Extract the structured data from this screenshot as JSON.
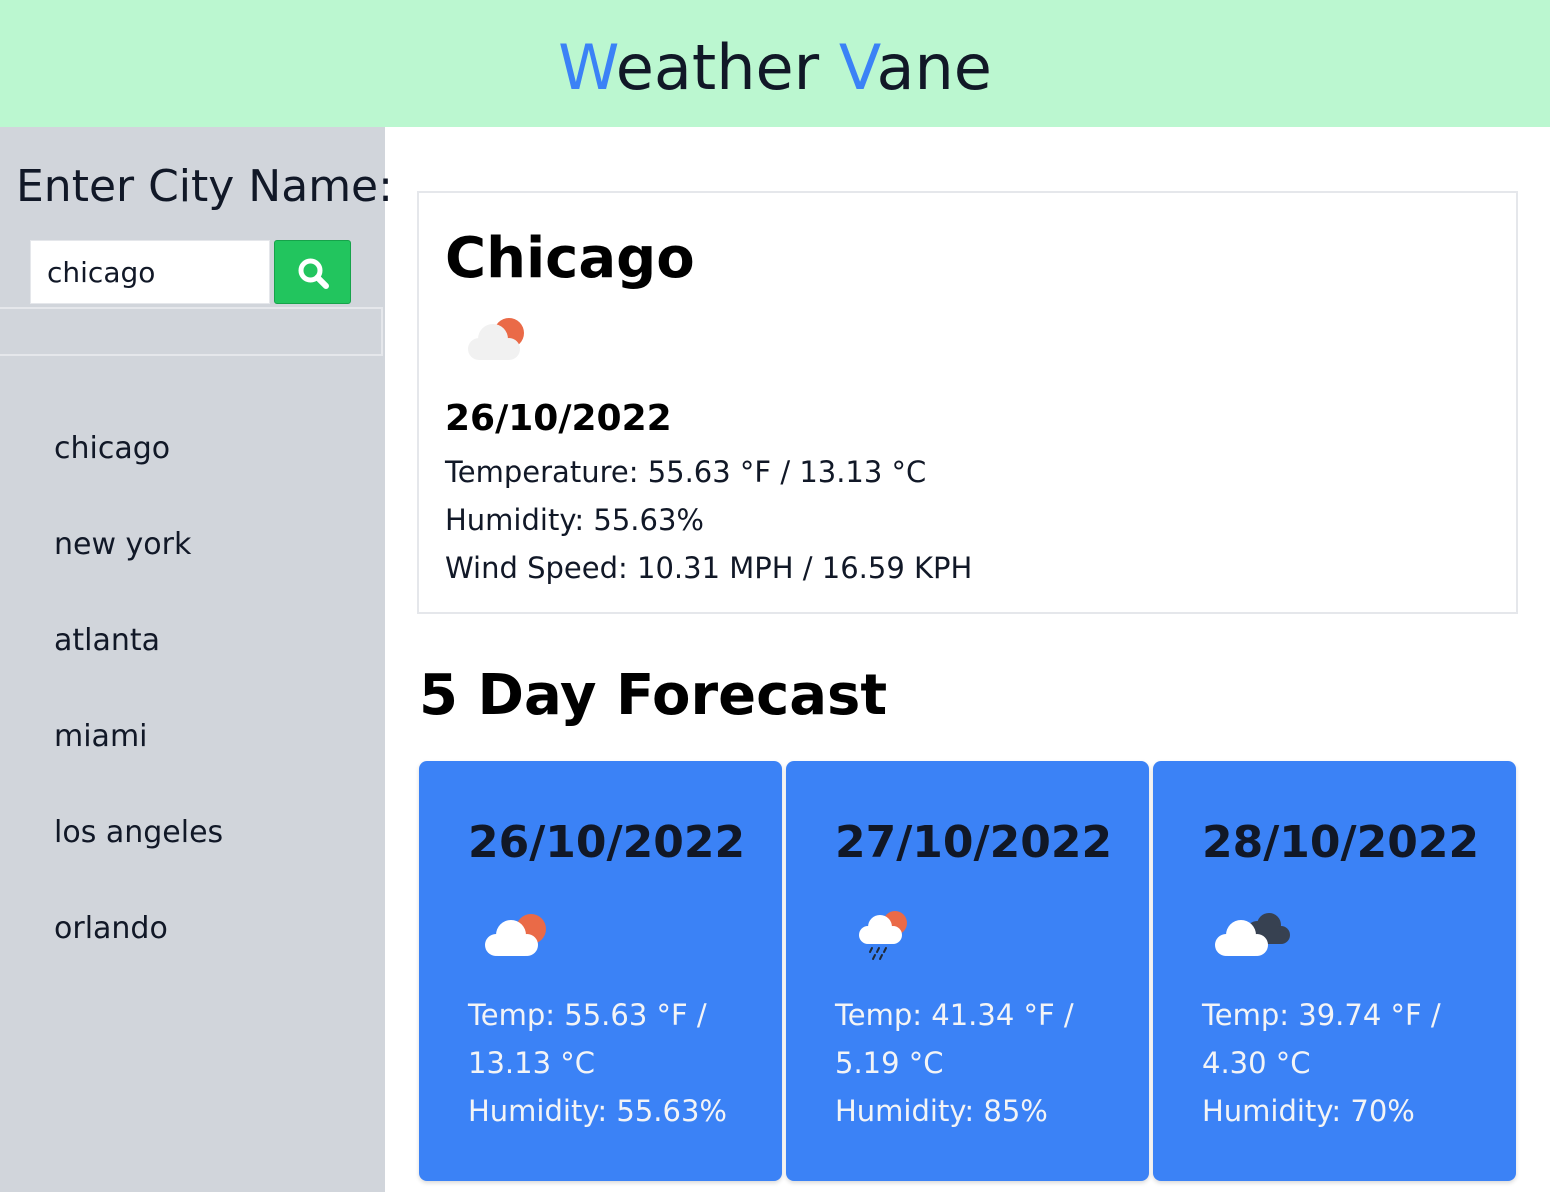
{
  "header": {
    "title_w1": "W",
    "title_rest1": "eather ",
    "title_w2": "V",
    "title_rest2": "ane"
  },
  "sidebar": {
    "label": "Enter City Name:",
    "search_value": "chicago",
    "search_icon": "search-icon",
    "history": [
      "chicago",
      "new york",
      "atlanta",
      "miami",
      "los angeles",
      "orlando"
    ]
  },
  "current": {
    "city": "Chicago",
    "icon": "cloud-sun-icon",
    "date": "26/10/2022",
    "temperature": "Temperature: 55.63 °F / 13.13 °C",
    "humidity": "Humidity: 55.63%",
    "wind": "Wind Speed: 10.31 MPH / 16.59 KPH"
  },
  "forecast": {
    "heading": "5 Day Forecast",
    "days": [
      {
        "date": "26/10/2022",
        "icon": "cloud-sun-icon",
        "temp": "Temp: 55.63 °F / 13.13 °C",
        "humidity": "Humidity: 55.63%"
      },
      {
        "date": "27/10/2022",
        "icon": "rain-cloud-sun-icon",
        "temp": "Temp: 41.34 °F / 5.19 °C",
        "humidity": "Humidity: 85%"
      },
      {
        "date": "28/10/2022",
        "icon": "dark-clouds-icon",
        "temp": "Temp: 39.74 °F / 4.30 °C",
        "humidity": "Humidity: 70%"
      }
    ]
  },
  "colors": {
    "header_bg": "#bbf7d0",
    "accent": "#3b82f6",
    "sidebar_bg": "#d1d5db",
    "search_button": "#22c55e",
    "card_bg": "#3b82f6"
  }
}
